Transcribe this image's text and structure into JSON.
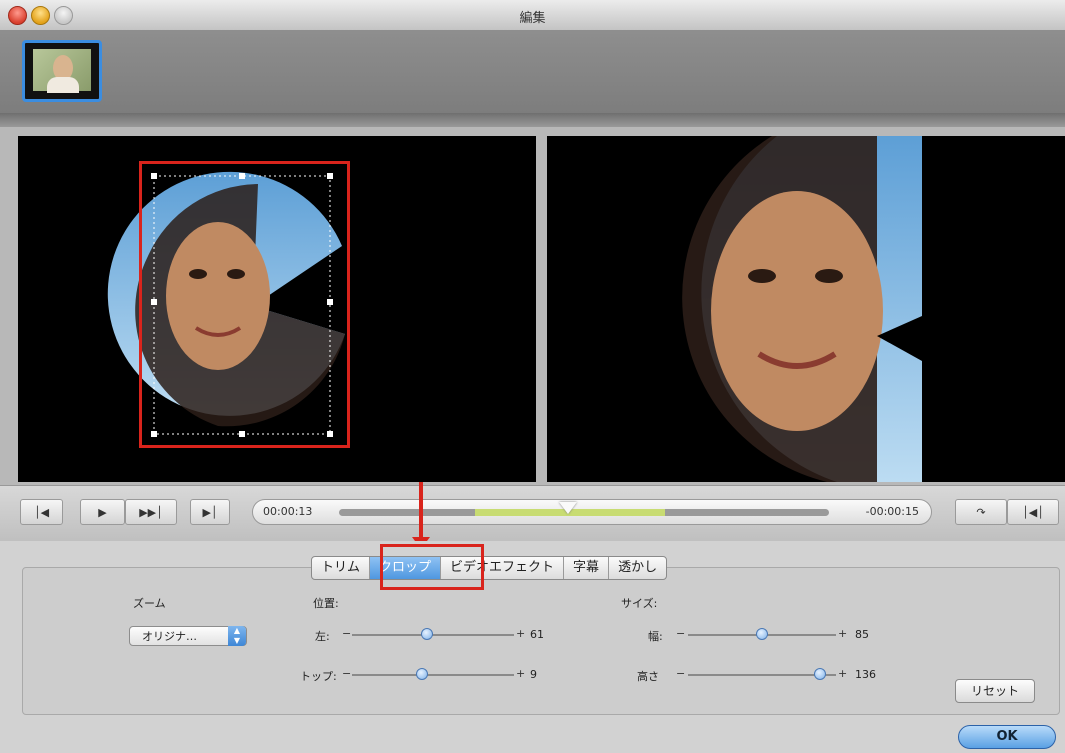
{
  "window": {
    "title": "編集"
  },
  "player": {
    "time_current": "00:00:13",
    "time_remaining": "-00:00:15"
  },
  "tabs": [
    {
      "label": "トリム",
      "active": false
    },
    {
      "label": "クロップ",
      "active": true
    },
    {
      "label": "ビデオエフェクト",
      "active": false
    },
    {
      "label": "字幕",
      "active": false
    },
    {
      "label": "透かし",
      "active": false
    }
  ],
  "crop": {
    "zoom_label": "ズーム",
    "zoom_value": "オリジナ…",
    "position_label": "位置:",
    "size_label": "サイズ:",
    "left_label": "左:",
    "left_value": "61",
    "top_label": "トップ:",
    "top_value": "9",
    "width_label": "幅:",
    "width_value": "85",
    "height_label": "高さ",
    "height_value": "136",
    "minus": "−",
    "plus": "+"
  },
  "buttons": {
    "reset": "リセット",
    "ok": "OK"
  },
  "colors": {
    "accent": "#4f97e0",
    "highlight": "#d9241c",
    "selection": "#c8dc72"
  }
}
